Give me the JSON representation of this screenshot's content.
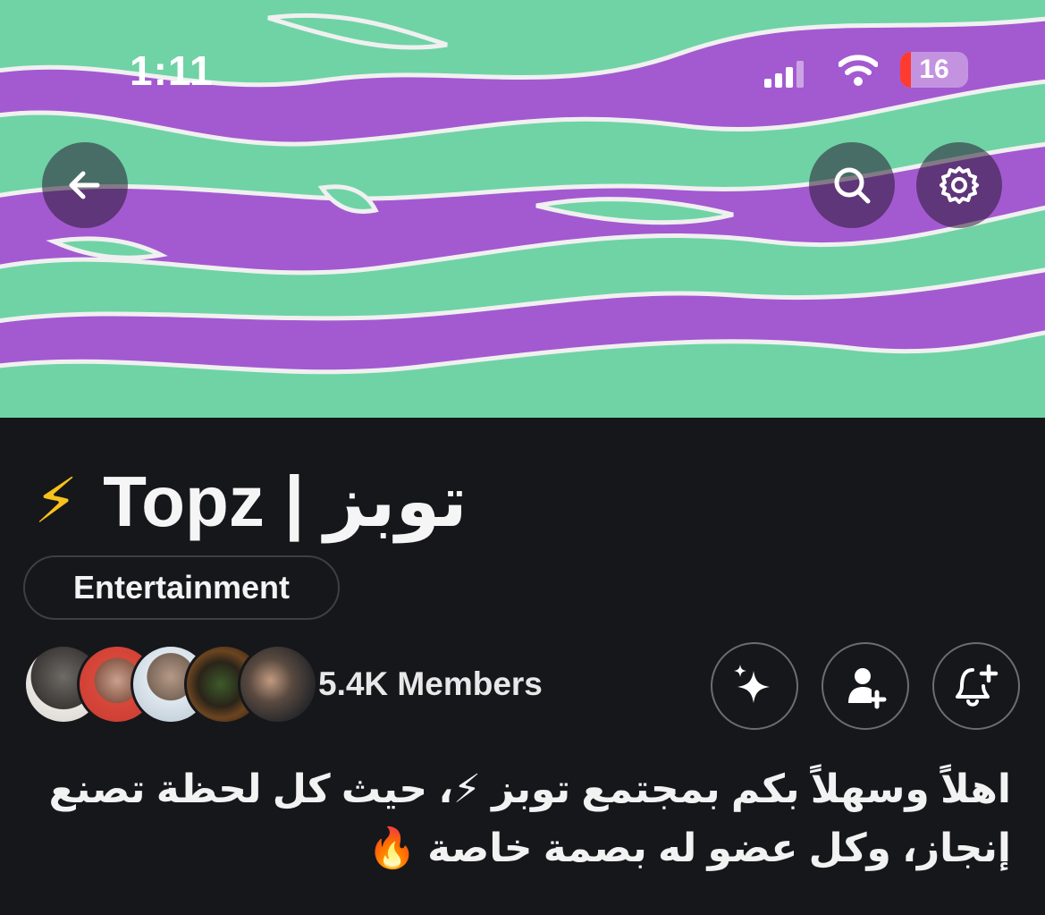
{
  "status_bar": {
    "time": "1:11",
    "battery": "16",
    "colors": {
      "battery_low": "#ff3b30"
    }
  },
  "banner": {
    "colors": {
      "purple": "#a35ad0",
      "green": "#6fd3a6",
      "outline": "#f0f0f0"
    },
    "back_icon": "arrow-left-icon",
    "search_icon": "search-icon",
    "settings_icon": "gear-icon"
  },
  "community": {
    "title": "توبز | Topz",
    "title_emoji": "⚡",
    "category": "Entertainment",
    "members": "5.4K Members",
    "description_lines": [
      "اهلاً وسهلاً بكم بمجتمع توبز ⚡، حيث كل لحظة تصنع",
      "إنجاز، وكل عضو له بصمة خاصة 🔥"
    ]
  },
  "actions": {
    "ai_icon": "sparkles-icon",
    "invite_icon": "add-user-icon",
    "notify_icon": "bell-plus-icon"
  }
}
